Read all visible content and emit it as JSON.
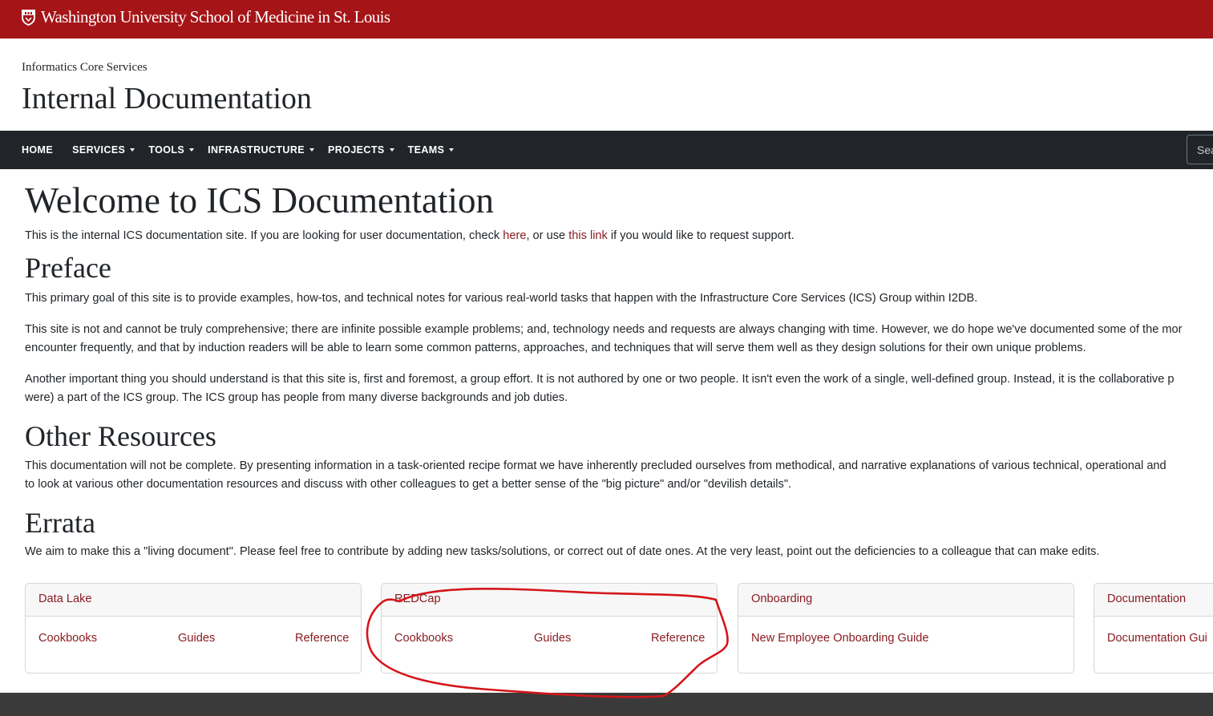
{
  "brand": {
    "name": "Washington University School of Medicine in St. Louis",
    "crest_icon": "wustl-crest-icon",
    "bar_color": "#a51417"
  },
  "site": {
    "subtitle": "Informatics Core Services",
    "title": "Internal Documentation"
  },
  "nav": {
    "items": [
      {
        "label": "HOME",
        "dropdown": false
      },
      {
        "label": "SERVICES",
        "dropdown": true
      },
      {
        "label": "TOOLS",
        "dropdown": true
      },
      {
        "label": "INFRASTRUCTURE",
        "dropdown": true
      },
      {
        "label": "PROJECTS",
        "dropdown": true
      },
      {
        "label": "TEAMS",
        "dropdown": true
      }
    ],
    "search_placeholder": "Search"
  },
  "content": {
    "welcome_heading": "Welcome to ICS Documentation",
    "intro": {
      "before": "This is the internal ICS documentation site. If you are looking for user documentation, check ",
      "link1": "here",
      "middle": ", or use ",
      "link2": "this link",
      "after": " if you would like to request support."
    },
    "preface_heading": "Preface",
    "preface_p1": "This primary goal of this site is to provide examples, how-tos, and technical notes for various real-world tasks that happen with the Infrastructure Core Services (ICS) Group within I2DB.",
    "preface_p2_l1": "This site is not and cannot be truly comprehensive; there are infinite possible example problems; and, technology needs and requests are always changing with time. However, we do hope we've documented some of the mor",
    "preface_p2_l2": "encounter frequently, and that by induction readers will be able to learn some common patterns, approaches, and techniques that will serve them well as they design solutions for their own unique problems.",
    "preface_p3_l1": "Another important thing you should understand is that this site is, first and foremost, a group effort. It is not authored by one or two people. It isn't even the work of a single, well-defined group. Instead, it is the collaborative p",
    "preface_p3_l2": "were) a part of the ICS group. The ICS group has people from many diverse backgrounds and job duties.",
    "other_heading": "Other Resources",
    "other_p_l1": "This documentation will not be complete. By presenting information in a task-oriented recipe format we have inherently precluded ourselves from methodical, and narrative explanations of various technical, operational and",
    "other_p_l2": "to look at various other documentation resources and discuss with other colleagues to get a better sense of the \"big picture\" and/or \"devilish details\".",
    "errata_heading": "Errata",
    "errata_p": "We aim to make this a \"living document\". Please feel free to contribute by adding new tasks/solutions, or correct out of date ones. At the very least, point out the deficiencies to a colleague that can make edits."
  },
  "cards": [
    {
      "title": "Data Lake",
      "links": [
        "Cookbooks",
        "Guides",
        "Reference"
      ]
    },
    {
      "title": "REDCap",
      "links": [
        "Cookbooks",
        "Guides",
        "Reference"
      ]
    },
    {
      "title": "Onboarding",
      "links": [
        "New Employee Onboarding Guide"
      ]
    },
    {
      "title": "Documentation",
      "links": [
        "Documentation Gui"
      ]
    }
  ],
  "colors": {
    "link": "#8a1c22",
    "nav_bg": "#212529",
    "footer_bg": "#3a3a3a",
    "annotation": "#d4161c"
  }
}
